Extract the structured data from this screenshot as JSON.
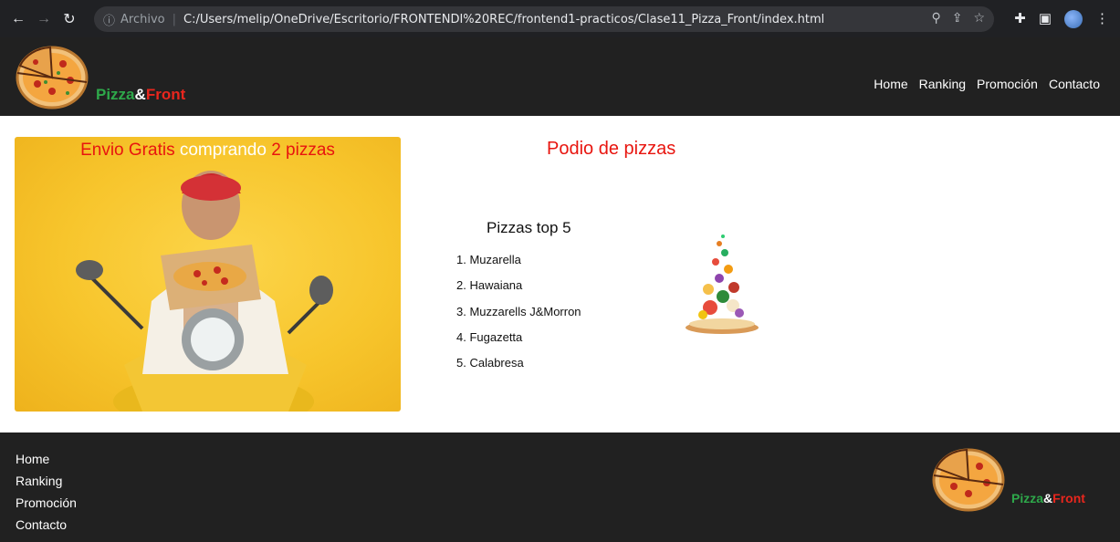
{
  "browser": {
    "scheme_label": "Archivo",
    "url": "C:/Users/melip/OneDrive/Escritorio/FRONTENDI%20REC/frontend1-practicos/Clase11_Pizza_Front/index.html",
    "icons": [
      "back-icon",
      "forward-icon",
      "reload-icon",
      "info-icon",
      "zoom-icon",
      "share-icon",
      "star-icon",
      "extensions-icon",
      "sidepanel-icon",
      "profile-avatar",
      "menu-icon"
    ]
  },
  "brand": {
    "part1": "Pizza",
    "amp": "&",
    "part2": "Front"
  },
  "nav": {
    "items": [
      "Home",
      "Ranking",
      "Promoción",
      "Contacto"
    ]
  },
  "promo": {
    "t1": "Envio Gratis",
    "t2": "comprando",
    "t3": "2 pizzas"
  },
  "podio": {
    "title": "Podio de pizzas",
    "subtitle": "Pizzas top 5",
    "items": [
      "1. Muzarella",
      "2. Hawaiana",
      "3. Muzzarells J&Morron",
      "4. Fugazetta",
      "5. Calabresa"
    ]
  },
  "footer": {
    "items": [
      "Home",
      "Ranking",
      "Promoción",
      "Contacto"
    ]
  },
  "colors": {
    "header_bg": "#212121",
    "brand_green": "#2ea84a",
    "brand_red": "#e8261d",
    "accent_red": "#e8150f",
    "promo_yellow": "#f7c52c"
  }
}
